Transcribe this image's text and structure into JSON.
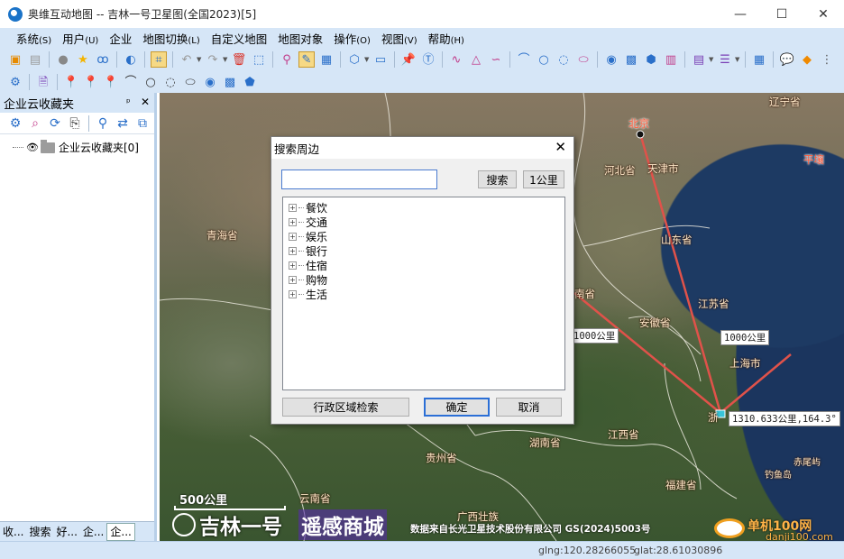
{
  "window": {
    "title": "奥维互动地图 -- 吉林一号卫星图(全国2023)[5]",
    "minimize": "—",
    "maximize": "☐",
    "close": "✕"
  },
  "menu": [
    {
      "label": "系统",
      "key": "(S)"
    },
    {
      "label": "用户",
      "key": "(U)"
    },
    {
      "label": "企业",
      "key": ""
    },
    {
      "label": "地图切换",
      "key": "(L)"
    },
    {
      "label": "自定义地图",
      "key": ""
    },
    {
      "label": "地图对象",
      "key": ""
    },
    {
      "label": "操作",
      "key": "(O)"
    },
    {
      "label": "视图",
      "key": "(V)"
    },
    {
      "label": "帮助",
      "key": "(H)"
    }
  ],
  "left_panel": {
    "title": "企业云收藏夹",
    "pin": "ᵖ",
    "close": "✕",
    "tree_root": "企业云收藏夹[0]",
    "tabs": [
      "收...",
      "搜索",
      "好...",
      "企...",
      "企..."
    ]
  },
  "dialog": {
    "title": "搜索周边",
    "search_value": "",
    "search_button": "搜索",
    "radius_button": "1公里",
    "categories": [
      "餐饮",
      "交通",
      "娱乐",
      "银行",
      "住宿",
      "购物",
      "生活"
    ],
    "region_button": "行政区域检索",
    "ok_button": "确定",
    "cancel_button": "取消"
  },
  "map": {
    "labels": [
      {
        "name": "北京",
        "style": "red"
      },
      {
        "name": "辽宁省",
        "style": "normal"
      },
      {
        "name": "天津市",
        "style": "normal"
      },
      {
        "name": "河北省",
        "style": "normal"
      },
      {
        "name": "平壤",
        "style": "red"
      },
      {
        "name": "青海省",
        "style": "normal"
      },
      {
        "name": "山东省",
        "style": "normal"
      },
      {
        "name": "江苏省",
        "style": "normal"
      },
      {
        "name": "安徽省",
        "style": "normal"
      },
      {
        "name": "南省",
        "style": "normal"
      },
      {
        "name": "上海市",
        "style": "normal"
      },
      {
        "name": "浙",
        "style": "normal"
      },
      {
        "name": "湖南省",
        "style": "normal"
      },
      {
        "name": "江西省",
        "style": "normal"
      },
      {
        "name": "贵州省",
        "style": "normal"
      },
      {
        "name": "福建省",
        "style": "normal"
      },
      {
        "name": "云南省",
        "style": "normal"
      },
      {
        "name": "广西壮族",
        "style": "normal"
      },
      {
        "name": "赤尾屿",
        "style": "normal"
      },
      {
        "name": "钓鱼岛",
        "style": "normal"
      }
    ],
    "distance_labels": [
      "1000公里",
      "1000公里",
      "1310.633公里,164.3°"
    ],
    "scale": "500公里",
    "brand_jilin": "吉林一号",
    "brand_mall": "遥感商城",
    "copyright": "数据来自长光卫星技术股份有限公司 GS(2024)5003号",
    "watermark": "单机100网",
    "watermark_sub": "danji100.com"
  },
  "status": {
    "lng": "glng:120.28266055",
    "lat": "glat:28.61030896"
  }
}
